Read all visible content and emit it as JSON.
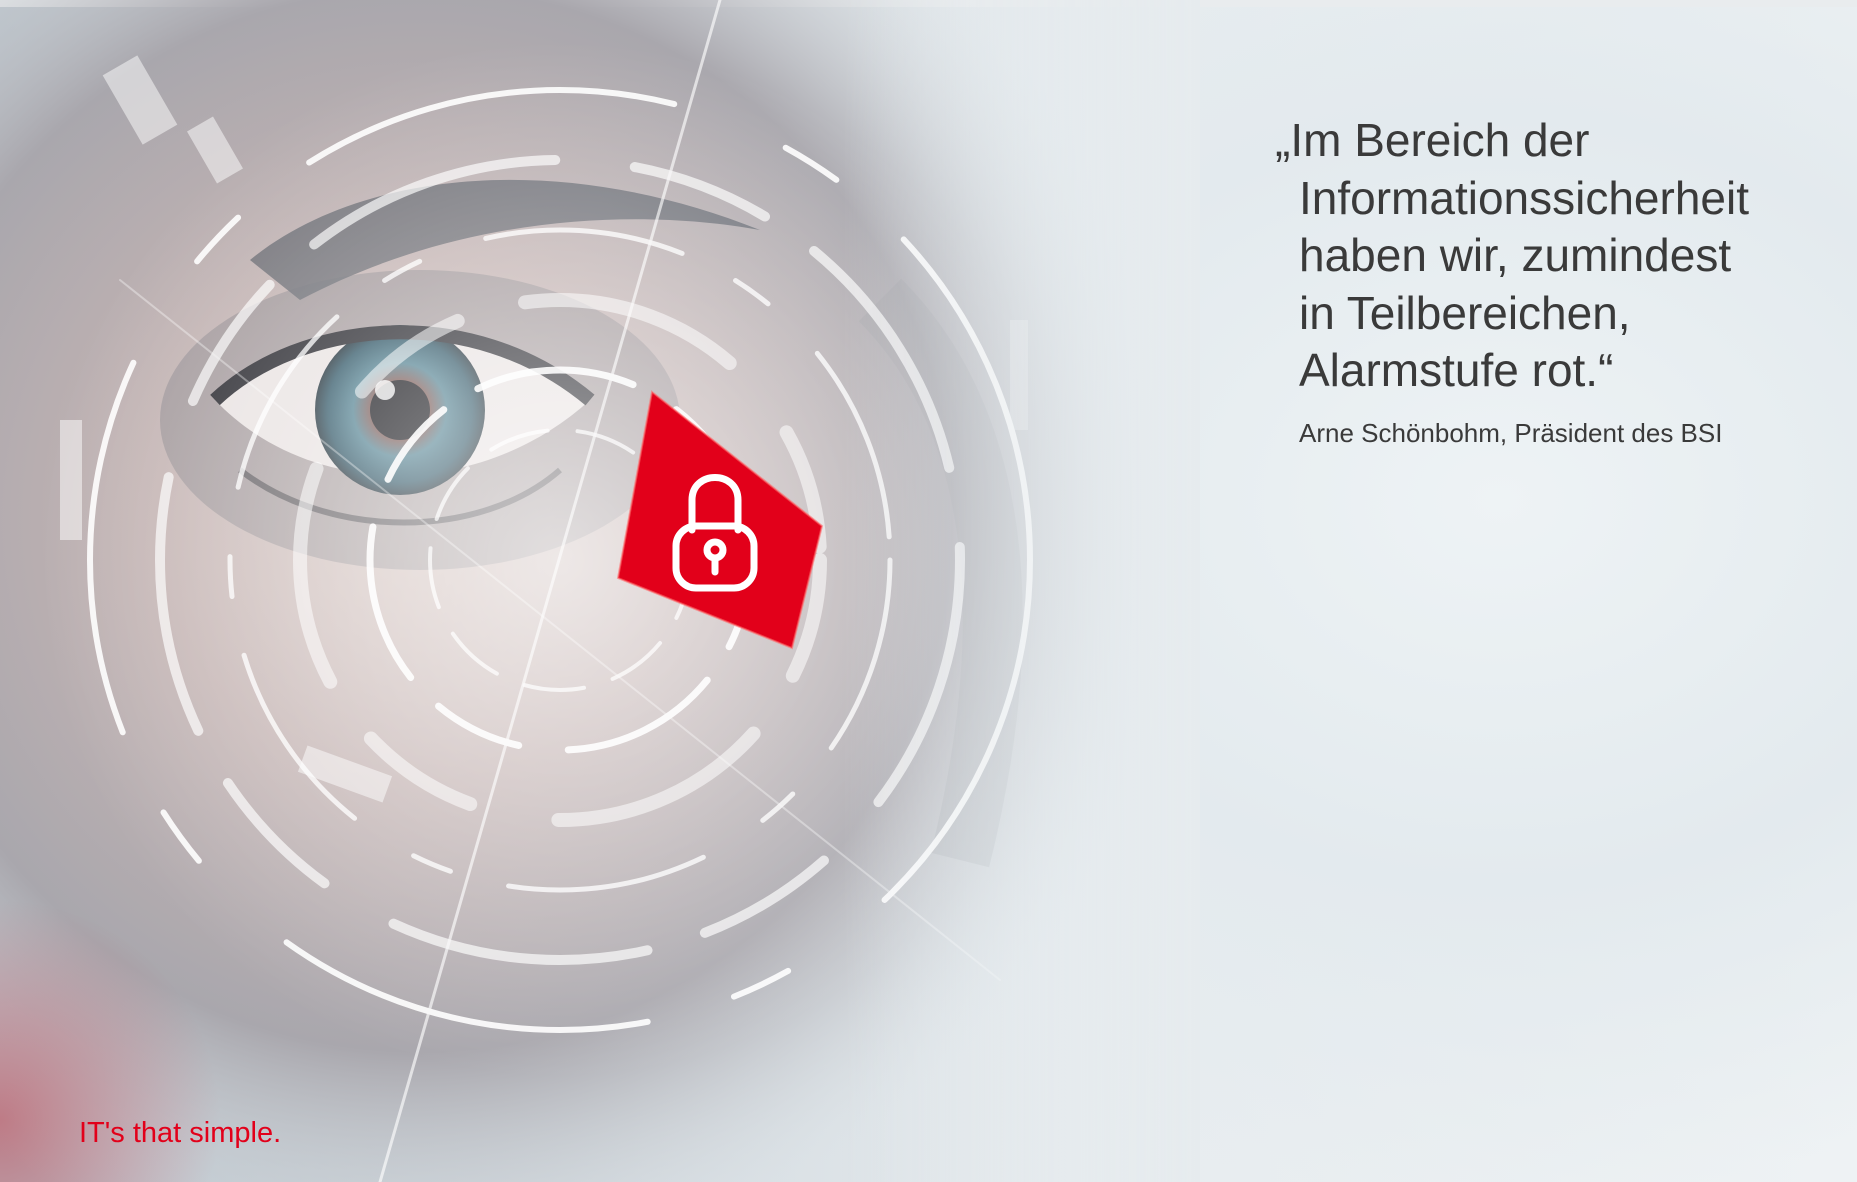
{
  "quote": {
    "lines": [
      "„Im Bereich der",
      "Informationssicherheit",
      "haben wir, zumindest",
      "in Teilbereichen,",
      "Alarmstufe rot.“"
    ],
    "attribution": "Arne Schönbohm, Präsident des BSI"
  },
  "tagline": "IT's that simple.",
  "colors": {
    "accent": "#e2001a",
    "text": "#3a3a3a"
  },
  "hero_image": {
    "icon": "padlock-icon"
  }
}
